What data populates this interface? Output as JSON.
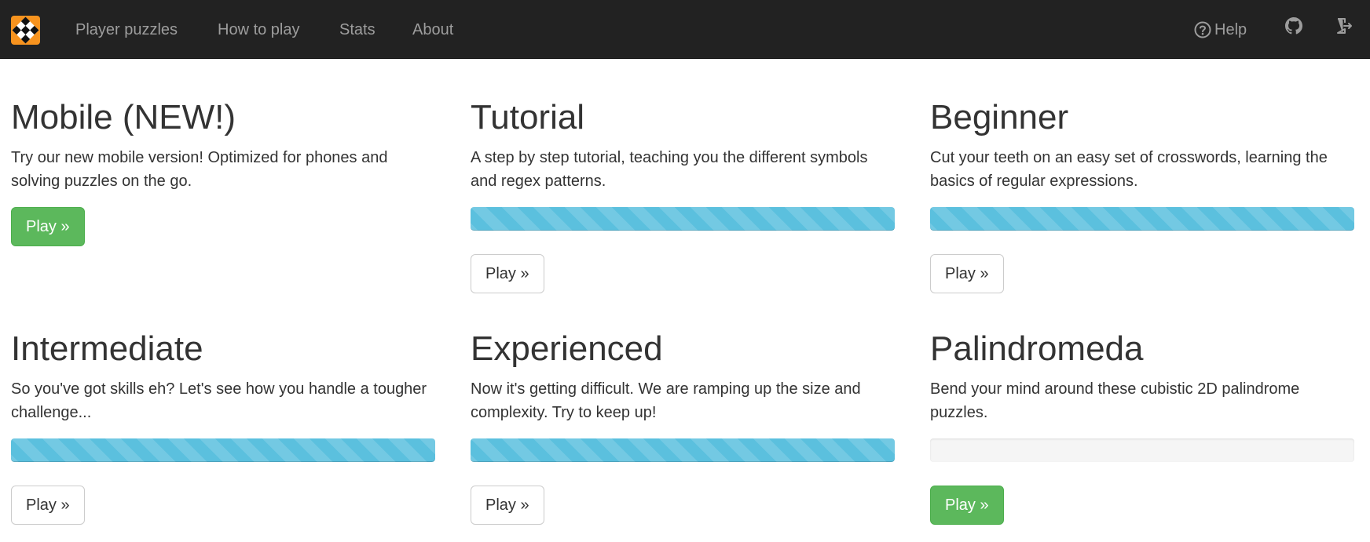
{
  "navbar": {
    "logo_icon": "regex-crossword-logo-icon",
    "links": [
      "Player puzzles",
      "How to play",
      "Stats",
      "About"
    ],
    "help_label": "Help",
    "help_icon": "question-circle-icon",
    "github_icon": "github-icon",
    "logout_icon": "sign-out-icon"
  },
  "colors": {
    "navbar_bg": "#222222",
    "brand": "#f7931e",
    "success": "#5cb85c",
    "progress_info": "#5bc0de"
  },
  "panels": [
    {
      "title": "Mobile (NEW!)",
      "description": "Try our new mobile version! Optimized for phones and solving puzzles on the go.",
      "has_progress": false,
      "button_label": "Play »",
      "button_style": "success"
    },
    {
      "title": "Tutorial",
      "description": "A step by step tutorial, teaching you the different symbols and regex patterns.",
      "has_progress": true,
      "progress_percent": 100,
      "button_label": "Play »",
      "button_style": "default"
    },
    {
      "title": "Beginner",
      "description": "Cut your teeth on an easy set of crosswords, learning the basics of regular expressions.",
      "has_progress": true,
      "progress_percent": 100,
      "button_label": "Play »",
      "button_style": "default"
    },
    {
      "title": "Intermediate",
      "description": "So you've got skills eh? Let's see how you handle a tougher challenge...",
      "has_progress": true,
      "progress_percent": 100,
      "button_label": "Play »",
      "button_style": "default"
    },
    {
      "title": "Experienced",
      "description": "Now it's getting difficult. We are ramping up the size and complexity. Try to keep up!",
      "has_progress": true,
      "progress_percent": 100,
      "button_label": "Play »",
      "button_style": "default"
    },
    {
      "title": "Palindromeda",
      "description": "Bend your mind around these cubistic 2D palindrome puzzles.",
      "has_progress": true,
      "progress_percent": 0,
      "button_label": "Play »",
      "button_style": "success"
    }
  ]
}
